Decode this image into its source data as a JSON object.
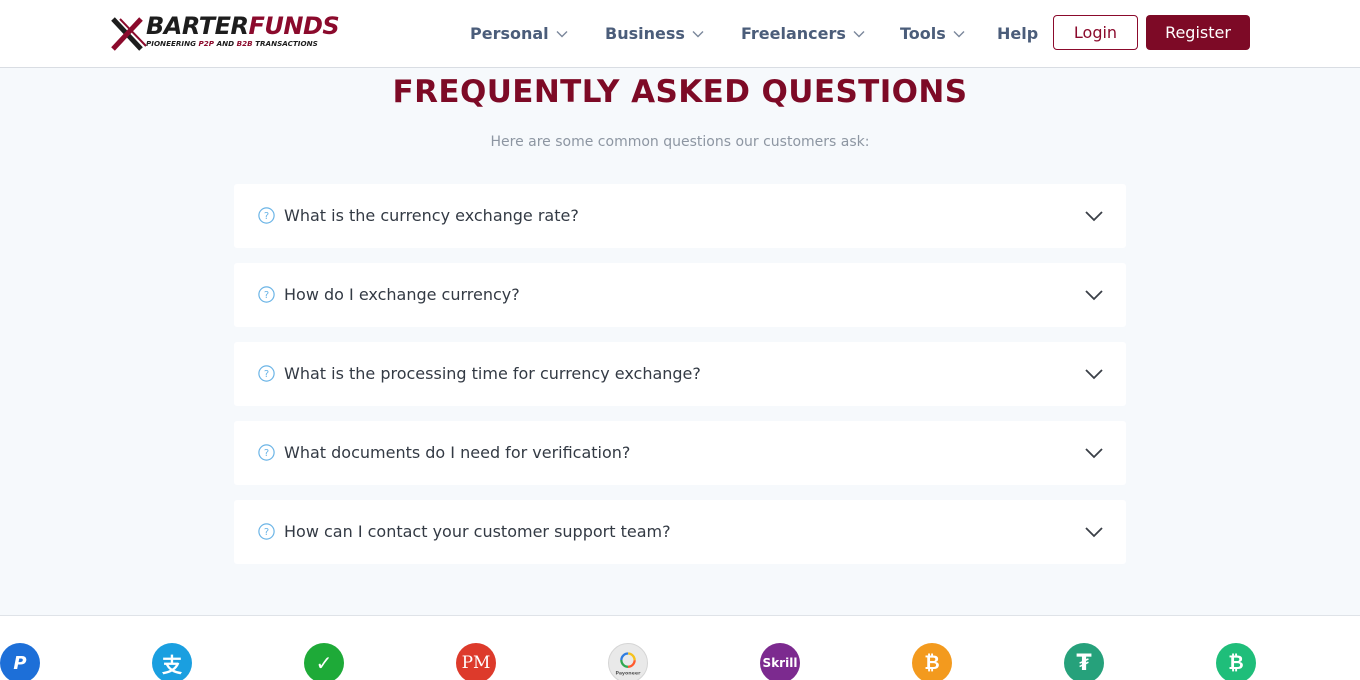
{
  "header": {
    "logo": {
      "word_barter": "BARTER",
      "word_funds": "FUNDS",
      "tagline_a": "PIONEERING ",
      "tagline_b": "P2P",
      "tagline_c": " AND ",
      "tagline_d": "B2B",
      "tagline_e": " TRANSACTIONS"
    },
    "nav": {
      "personal": "Personal",
      "business": "Business",
      "freelancers": "Freelancers",
      "tools": "Tools",
      "help": "Help"
    },
    "login_label": "Login",
    "register_label": "Register"
  },
  "faq": {
    "title": "FREQUENTLY ASKED QUESTIONS",
    "subtitle": "Here are some common questions our customers ask:",
    "items": [
      {
        "question": "What is the currency exchange rate?"
      },
      {
        "question": "How do I exchange currency?"
      },
      {
        "question": "What is the processing time for currency exchange?"
      },
      {
        "question": "What documents do I need for verification?"
      },
      {
        "question": "How can I contact your customer support team?"
      }
    ]
  },
  "payment_methods": {
    "paypal": "P",
    "alipay": "支",
    "wechat": "✓",
    "perfect_money": "PM",
    "payoneer": "Payoneer",
    "skrill": "Skrill",
    "bitcoin": "₿",
    "tether": "₮",
    "bitcoin_cash": "₿"
  },
  "colors": {
    "brand": "#7d0a26",
    "nav_text": "#4b5d7a",
    "page_bg": "#f6f9fc",
    "question_icon": "#6ab4e6"
  }
}
